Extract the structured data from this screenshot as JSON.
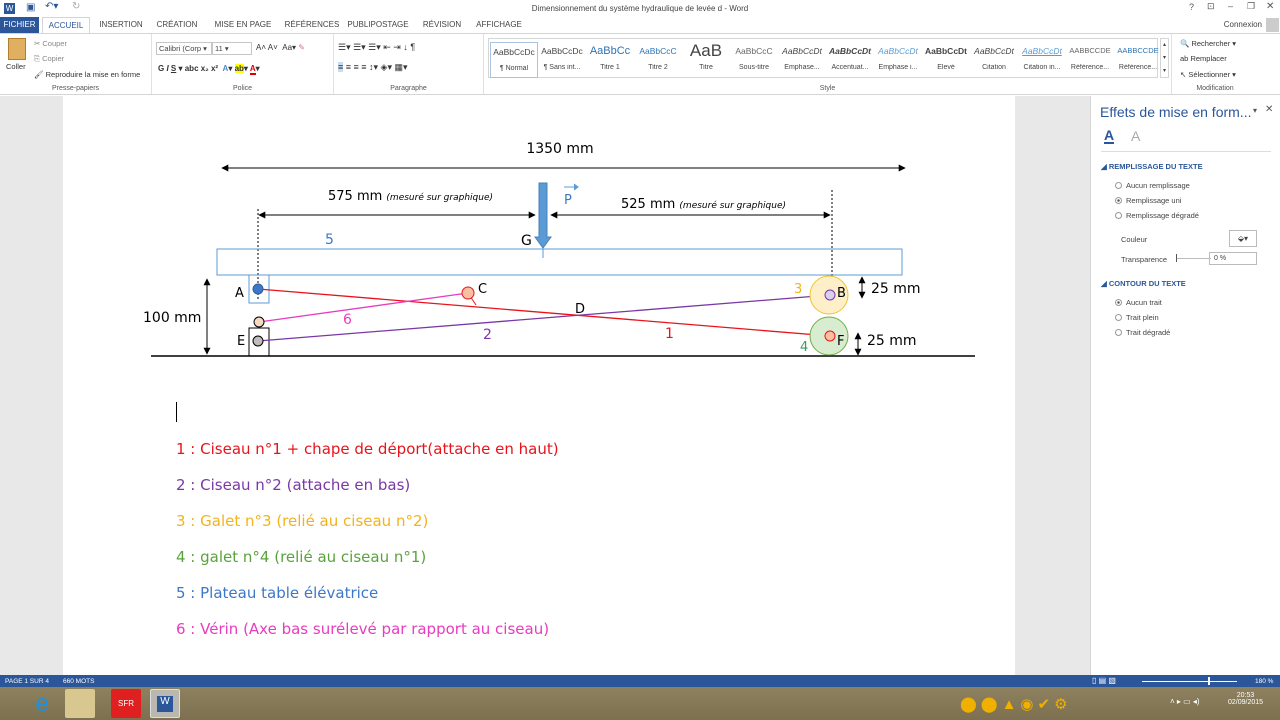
{
  "window": {
    "title": "Dimensionnement du système hydraulique de levée d - Word",
    "help": "?",
    "connexion": "Connexion"
  },
  "tabs": [
    "FICHIER",
    "ACCUEIL",
    "INSERTION",
    "CRÉATION",
    "MISE EN PAGE",
    "RÉFÉRENCES",
    "PUBLIPOSTAGE",
    "RÉVISION",
    "AFFICHAGE"
  ],
  "ribbon": {
    "clipboard": {
      "paste": "Coller",
      "cut": "Couper",
      "copy": "Copier",
      "format_painter": "Reproduire la mise en forme",
      "label": "Presse-papiers"
    },
    "font": {
      "name": "Calibri (Corp",
      "size": "11",
      "label": "Police"
    },
    "paragraph": {
      "label": "Paragraphe"
    },
    "styles": {
      "label": "Style",
      "items": [
        {
          "preview": "AaBbCcDc",
          "name": "¶ Normal"
        },
        {
          "preview": "AaBbCcDc",
          "name": "¶ Sans int..."
        },
        {
          "preview": "AaBbCc",
          "name": "Titre 1"
        },
        {
          "preview": "AaBbCcC",
          "name": "Titre 2"
        },
        {
          "preview": "AaB",
          "name": "Titre"
        },
        {
          "preview": "AaBbCcC",
          "name": "Sous-titre"
        },
        {
          "preview": "AaBbCcDt",
          "name": "Emphase..."
        },
        {
          "preview": "AaBbCcDt",
          "name": "Accentuat..."
        },
        {
          "preview": "AaBbCcDt",
          "name": "Emphase i..."
        },
        {
          "preview": "AaBbCcDt",
          "name": "Élevé"
        },
        {
          "preview": "AaBbCcDt",
          "name": "Citation"
        },
        {
          "preview": "AaBbCcDt",
          "name": "Citation in..."
        },
        {
          "preview": "AABBCCDE",
          "name": "Référence..."
        },
        {
          "preview": "AABBCCDE",
          "name": "Référence..."
        }
      ]
    },
    "editing": {
      "find": "Rechercher",
      "replace": "Remplacer",
      "select": "Sélectionner",
      "label": "Modification"
    }
  },
  "diagram": {
    "total": "1350 mm",
    "left_dim": "575 mm",
    "right_dim": "525 mm",
    "measured": "(mesuré sur graphique)",
    "height": "100 mm",
    "roller_b": "25 mm",
    "roller_f": "25 mm",
    "force": "P",
    "points": {
      "A": "A",
      "B": "B",
      "C": "C",
      "D": "D",
      "E": "E",
      "F": "F",
      "G": "G"
    },
    "numbers": [
      "1",
      "2",
      "3",
      "4",
      "5",
      "6"
    ]
  },
  "legend": [
    {
      "text": "1 : Ciseau n°1 + chape de déport(attache en haut)",
      "color": "#e8141c"
    },
    {
      "text": "2 : Ciseau n°2 (attache en bas)",
      "color": "#7a37a6"
    },
    {
      "text": "3 : Galet n°3 (relié au ciseau n°2)",
      "color": "#f2b31c"
    },
    {
      "text": "4 : galet n°4 (relié au ciseau n°1)",
      "color": "#5aa33c"
    },
    {
      "text": "5 : Plateau table élévatrice",
      "color": "#3c78c8"
    },
    {
      "text": "6 : Vérin (Axe bas surélevé par rapport au ciseau)",
      "color": "#e83cc0"
    }
  ],
  "pane": {
    "title": "Effets de mise en form...",
    "fill_section": "REMPLISSAGE DU TEXTE",
    "fill_options": [
      "Aucun remplissage",
      "Remplissage uni",
      "Remplissage dégradé"
    ],
    "color_label": "Couleur",
    "transparency_label": "Transparence",
    "transparency_value": "0 %",
    "outline_section": "CONTOUR DU TEXTE",
    "outline_options": [
      "Aucun trait",
      "Trait plein",
      "Trait dégradé"
    ]
  },
  "status": {
    "page": "PAGE 1 SUR 4",
    "words": "660 MOTS",
    "zoom": "180 %"
  },
  "taskbar": {
    "time": "20:53",
    "date": "02/09/2015",
    "sfr": "SFR"
  }
}
